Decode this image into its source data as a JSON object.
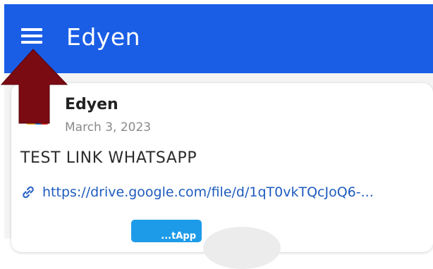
{
  "app_bar": {
    "title": "Edyen",
    "menu_icon": "hamburger-menu-icon",
    "background_color": "#1a5ee6"
  },
  "post": {
    "author": "Edyen",
    "date": "March 3, 2023",
    "title": "TEST LINK WHATSAPP",
    "link_icon": "link-icon",
    "link": "https://drive.google.com/file/d/1qT0vkTQcJoQ6-...",
    "thumbnail_badge": "...tApp"
  },
  "annotation": {
    "arrow_icon": "up-arrow-icon",
    "color": "#7a0b13"
  }
}
